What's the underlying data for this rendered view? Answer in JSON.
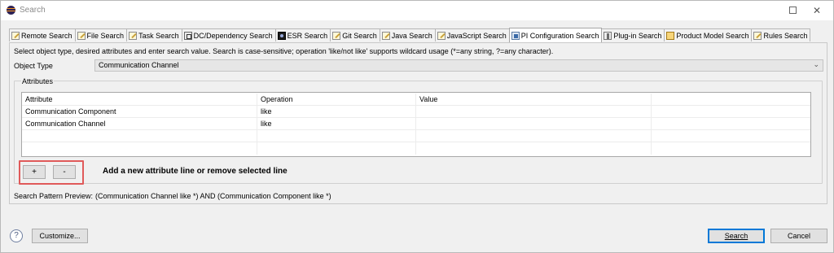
{
  "window": {
    "title": "Search",
    "maximize_symbol": "",
    "close_symbol": "✕"
  },
  "tabs": [
    {
      "label": "Remote Search",
      "icon": "pen-icon"
    },
    {
      "label": "File Search",
      "icon": "pen-icon"
    },
    {
      "label": "Task Search",
      "icon": "pen-icon"
    },
    {
      "label": "DC/Dependency Search",
      "icon": "dc-icon"
    },
    {
      "label": "ESR Search",
      "icon": "esr-icon"
    },
    {
      "label": "Git Search",
      "icon": "pen-icon"
    },
    {
      "label": "Java Search",
      "icon": "pen-icon"
    },
    {
      "label": "JavaScript Search",
      "icon": "pen-icon"
    },
    {
      "label": "PI Configuration Search",
      "icon": "pi-icon",
      "active": true
    },
    {
      "label": "Plug-in Search",
      "icon": "plugin-icon"
    },
    {
      "label": "Product Model Search",
      "icon": "product-icon"
    },
    {
      "label": "Rules Search",
      "icon": "pen-icon"
    }
  ],
  "panel": {
    "instructions": "Select object type, desired attributes and enter search value. Search is case-sensitive; operation 'like/not like' supports wildcard usage (*=any string, ?=any character).",
    "object_type_label": "Object Type",
    "object_type_value": "Communication Channel",
    "attributes_group_label": "Attributes",
    "table": {
      "columns": [
        "Attribute",
        "Operation",
        "Value",
        ""
      ],
      "rows": [
        [
          "Communication Component",
          "like",
          "",
          ""
        ],
        [
          "Communication Channel",
          "like",
          "",
          ""
        ],
        [
          "",
          "",
          "",
          ""
        ],
        [
          "",
          "",
          "",
          ""
        ]
      ]
    },
    "add_button_label": "+",
    "remove_button_label": "-",
    "hint": "Add a new attribute line or remove selected line",
    "preview_label": "Search Pattern Preview:",
    "preview_value": "(Communication Channel like *) AND (Communication Component like *)"
  },
  "footer": {
    "help_symbol": "?",
    "customize_label": "Customize...",
    "search_label": "Search",
    "cancel_label": "Cancel"
  },
  "colors": {
    "highlight": "#e05a5a",
    "focus": "#0078d7"
  }
}
